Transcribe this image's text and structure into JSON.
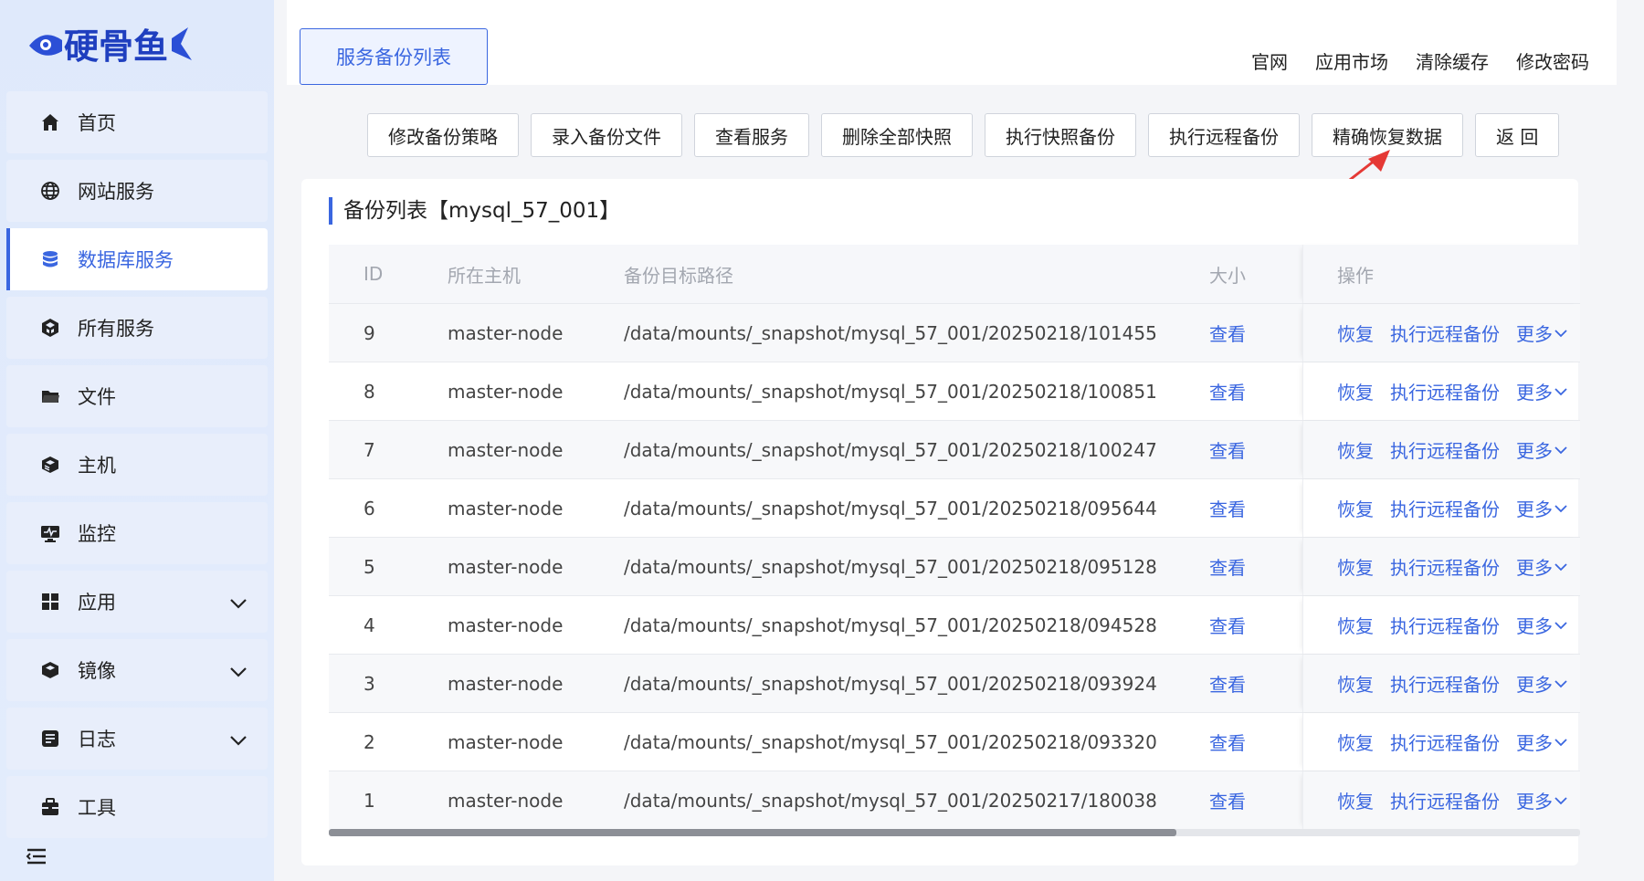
{
  "app": {
    "logo_text": "硬骨鱼"
  },
  "sidebar": {
    "items": [
      {
        "label": "首页",
        "icon": "home-icon"
      },
      {
        "label": "网站服务",
        "icon": "globe-icon"
      },
      {
        "label": "数据库服务",
        "icon": "database-icon",
        "active": true
      },
      {
        "label": "所有服务",
        "icon": "cubes-icon"
      },
      {
        "label": "文件",
        "icon": "folder-icon"
      },
      {
        "label": "主机",
        "icon": "server-icon"
      },
      {
        "label": "监控",
        "icon": "monitor-icon"
      },
      {
        "label": "应用",
        "icon": "apps-grid-icon",
        "expandable": true
      },
      {
        "label": "镜像",
        "icon": "box-icon",
        "expandable": true
      },
      {
        "label": "日志",
        "icon": "log-icon",
        "expandable": true
      },
      {
        "label": "工具",
        "icon": "toolbox-icon"
      }
    ]
  },
  "header": {
    "page_tab": "服务备份列表",
    "links": [
      "官网",
      "应用市场",
      "清除缓存",
      "修改密码"
    ]
  },
  "toolbar": {
    "buttons": [
      "修改备份策略",
      "录入备份文件",
      "查看服务",
      "删除全部快照",
      "执行快照备份",
      "执行远程备份",
      "精确恢复数据",
      "返 回"
    ]
  },
  "card": {
    "title": "备份列表【mysql_57_001】"
  },
  "table": {
    "columns": [
      "ID",
      "所在主机",
      "备份目标路径",
      "大小",
      "操作"
    ],
    "size_link": "查看",
    "actions": {
      "restore": "恢复",
      "remote": "执行远程备份",
      "more": "更多"
    },
    "rows": [
      {
        "id": "9",
        "host": "master-node",
        "path": "/data/mounts/_snapshot/mysql_57_001/20250218/101455"
      },
      {
        "id": "8",
        "host": "master-node",
        "path": "/data/mounts/_snapshot/mysql_57_001/20250218/100851"
      },
      {
        "id": "7",
        "host": "master-node",
        "path": "/data/mounts/_snapshot/mysql_57_001/20250218/100247"
      },
      {
        "id": "6",
        "host": "master-node",
        "path": "/data/mounts/_snapshot/mysql_57_001/20250218/095644"
      },
      {
        "id": "5",
        "host": "master-node",
        "path": "/data/mounts/_snapshot/mysql_57_001/20250218/095128"
      },
      {
        "id": "4",
        "host": "master-node",
        "path": "/data/mounts/_snapshot/mysql_57_001/20250218/094528"
      },
      {
        "id": "3",
        "host": "master-node",
        "path": "/data/mounts/_snapshot/mysql_57_001/20250218/093924"
      },
      {
        "id": "2",
        "host": "master-node",
        "path": "/data/mounts/_snapshot/mysql_57_001/20250218/093320"
      },
      {
        "id": "1",
        "host": "master-node",
        "path": "/data/mounts/_snapshot/mysql_57_001/20250217/180038"
      }
    ]
  },
  "colors": {
    "accent": "#3a66e0",
    "annotation_arrow": "#e53935"
  }
}
